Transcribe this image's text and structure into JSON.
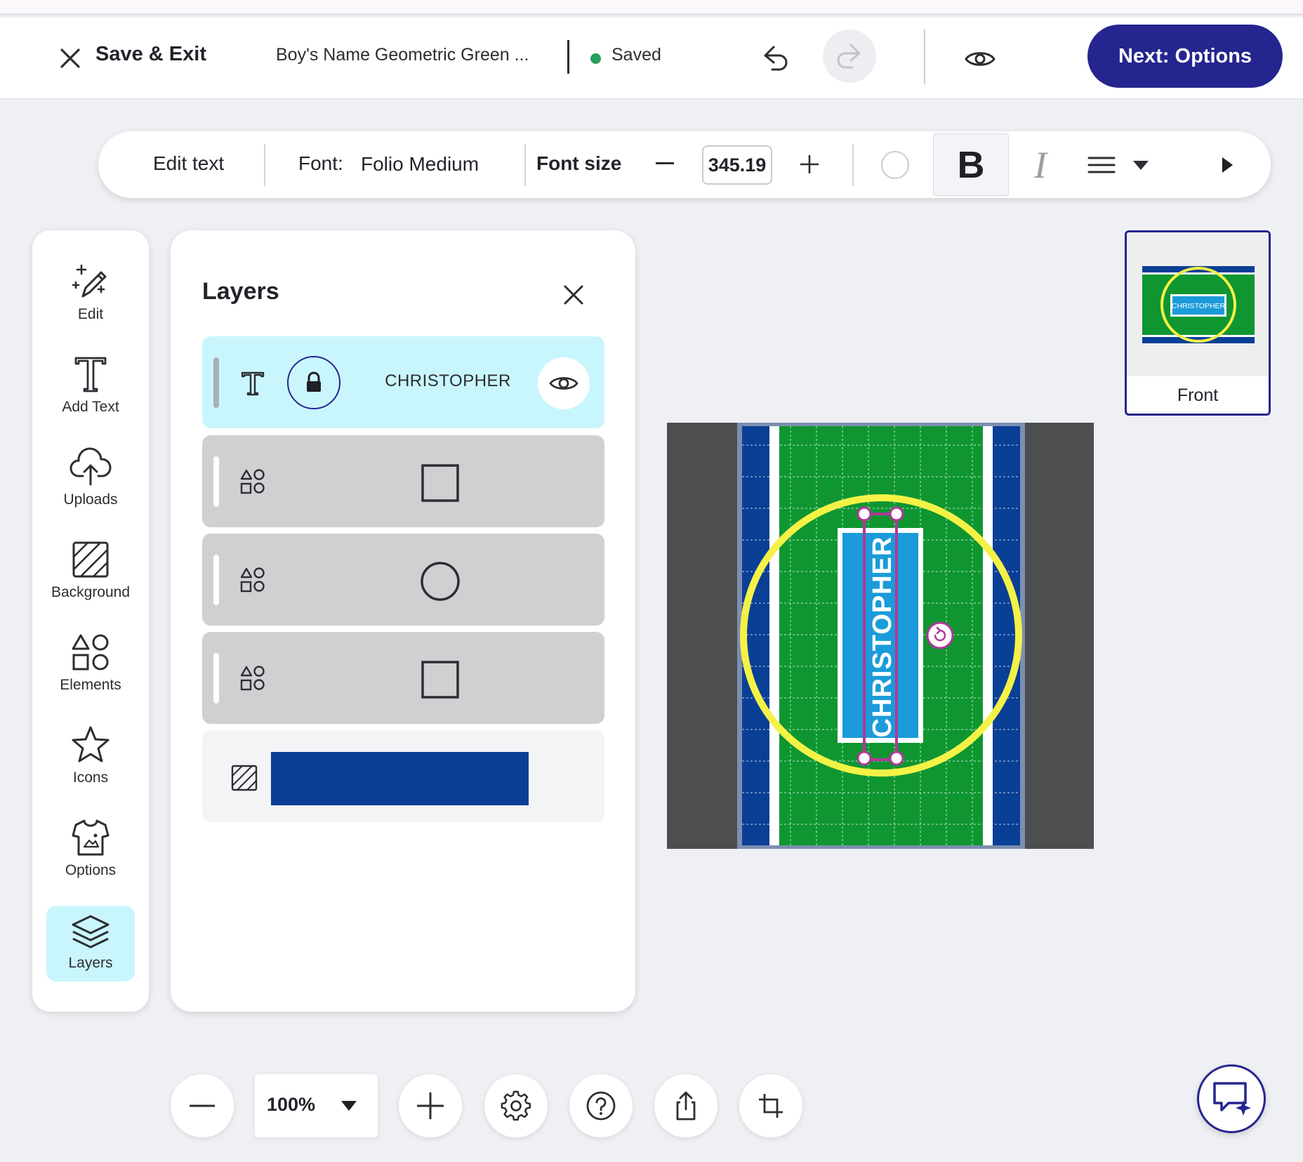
{
  "header": {
    "save_exit_label": "Save & Exit",
    "document_title": "Boy's Name Geometric Green ...",
    "save_status": "Saved",
    "next_button_label": "Next: Options",
    "status_color": "#27a05a",
    "accent_color": "#25258f"
  },
  "text_toolbar": {
    "edit_text_label": "Edit text",
    "font_label": "Font:",
    "font_value": "Folio Medium",
    "font_size_label": "Font size",
    "font_size_value": "345.19",
    "bold_glyph": "B",
    "italic_glyph": "I"
  },
  "sidebar": {
    "items": [
      {
        "label": "Edit",
        "icon": "magic-pencil-icon"
      },
      {
        "label": "Add Text",
        "icon": "text-icon"
      },
      {
        "label": "Uploads",
        "icon": "cloud-upload-icon"
      },
      {
        "label": "Background",
        "icon": "background-icon"
      },
      {
        "label": "Elements",
        "icon": "shapes-icon"
      },
      {
        "label": "Icons",
        "icon": "star-icon"
      },
      {
        "label": "Options",
        "icon": "tshirt-icon"
      },
      {
        "label": "Layers",
        "icon": "layers-icon",
        "active": true
      }
    ]
  },
  "layers_panel": {
    "title": "Layers",
    "layers": [
      {
        "type": "text",
        "name": "CHRISTOPHER",
        "locked": true,
        "selected": true
      },
      {
        "type": "shape",
        "shape": "square"
      },
      {
        "type": "shape",
        "shape": "circle"
      },
      {
        "type": "shape",
        "shape": "square"
      },
      {
        "type": "background",
        "color": "#0a3f96"
      }
    ]
  },
  "canvas": {
    "text": "CHRISTOPHER",
    "colors": {
      "field": "#0f9631",
      "stripe": "#0a3f96",
      "ring": "#f4f246",
      "panel": "#1b9bd9",
      "frame": "#4d4e50"
    }
  },
  "pages": [
    {
      "label": "Front",
      "thumb_text": "CHRISTOPHER"
    }
  ],
  "bottom_bar": {
    "zoom_value": "100%"
  }
}
